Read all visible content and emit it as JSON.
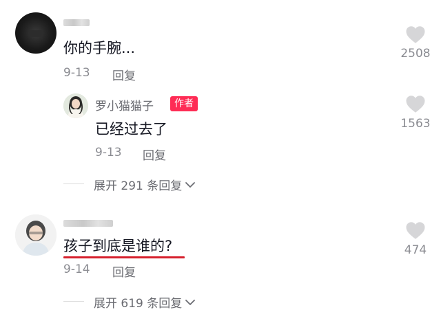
{
  "comments": [
    {
      "text": "你的手腕...",
      "date": "9-13",
      "reply_label": "回复",
      "likes": "2508",
      "reply": {
        "username": "罗小猫猫子",
        "badge": "作者",
        "text": "已经过去了",
        "date": "9-13",
        "reply_label": "回复",
        "likes": "1563"
      },
      "expand_label": "展开 291 条回复"
    },
    {
      "text": "孩子到底是谁的?",
      "date": "9-14",
      "reply_label": "回复",
      "likes": "474",
      "expand_label": "展开 619 条回复"
    }
  ],
  "icons": {
    "like": "heart-icon",
    "expand": "chevron-down-icon"
  },
  "colors": {
    "badge": "#fe2c55",
    "highlight_underline": "#d61f2c",
    "like_icon": "#d6d6d8"
  }
}
